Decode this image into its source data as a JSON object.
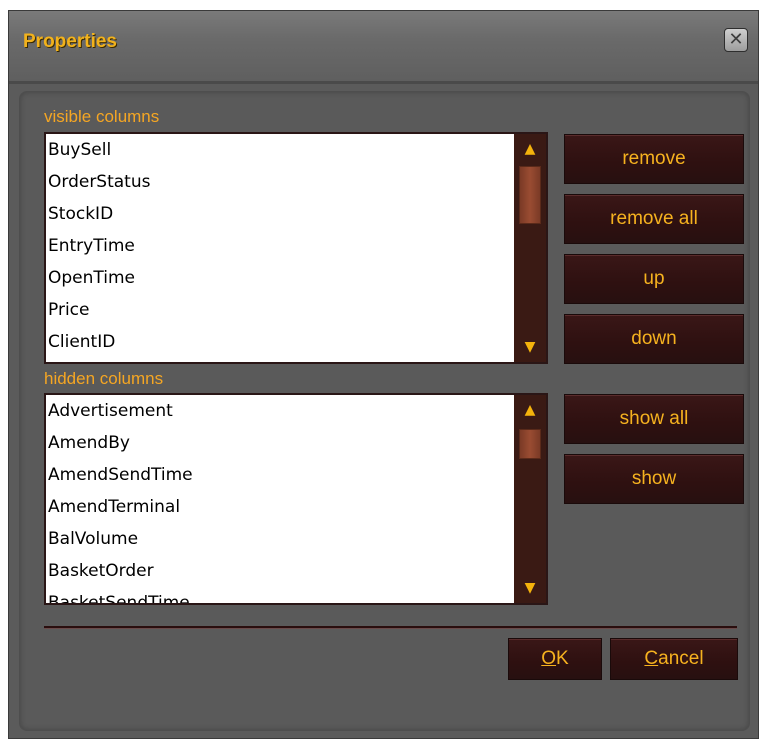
{
  "window": {
    "title": "Properties",
    "close_icon": "close-icon"
  },
  "visible_columns": {
    "label": "visible columns",
    "items": [
      "BuySell",
      "OrderStatus",
      "StockID",
      "EntryTime",
      "OpenTime",
      "Price",
      "ClientID"
    ]
  },
  "hidden_columns": {
    "label": "hidden columns",
    "items": [
      "Advertisement",
      "AmendBy",
      "AmendSendTime",
      "AmendTerminal",
      "BalVolume",
      "BasketOrder",
      "BasketSendTime"
    ]
  },
  "buttons": {
    "remove": "remove",
    "remove_all": "remove all",
    "up": "up",
    "down": "down",
    "show_all": "show all",
    "show": "show",
    "ok_access": "O",
    "ok_rest": "K",
    "cancel_access": "C",
    "cancel_rest": "ancel"
  },
  "colors": {
    "accent": "#f5a623",
    "title": "#f2b21c",
    "button_bg": "#2e1010",
    "panel_bg": "#5a5a5a"
  }
}
